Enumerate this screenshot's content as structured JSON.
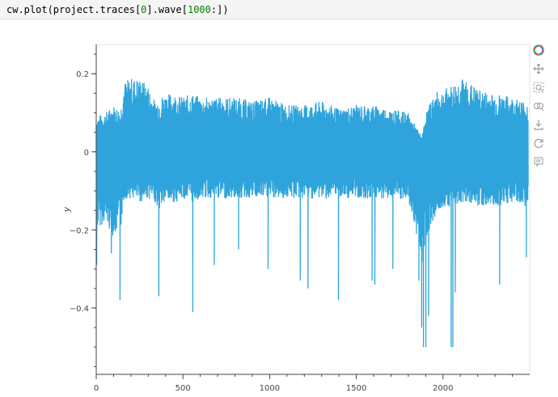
{
  "code": {
    "prefix": "cw.plot(project.traces[",
    "index": "0",
    "middle": "].wave[",
    "slice_start": "1000",
    "suffix": ":])"
  },
  "toolbar": {
    "items": [
      "bokeh-logo-icon",
      "pan-icon",
      "box-zoom-icon",
      "wheel-zoom-icon",
      "save-icon",
      "reset-icon",
      "hover-icon"
    ]
  },
  "chart_data": {
    "type": "line",
    "xlabel": "",
    "ylabel": "y",
    "xlim": [
      0,
      2500
    ],
    "ylim": [
      -0.57,
      0.275
    ],
    "x_ticks": [
      0,
      500,
      1000,
      1500,
      2000
    ],
    "y_ticks": [
      0.2,
      0,
      -0.2,
      -0.4
    ],
    "x_tick_labels": [
      "0",
      "500",
      "1000",
      "1500",
      "2000"
    ],
    "y_tick_labels": [
      "0.2",
      "0",
      "−0.2",
      "−0.4"
    ],
    "series": [
      {
        "color": "#2fa4dc",
        "envelope": {
          "x": [
            0,
            50,
            100,
            140,
            160,
            200,
            250,
            300,
            340,
            360,
            400,
            450,
            500,
            550,
            600,
            700,
            800,
            900,
            1000,
            1100,
            1200,
            1300,
            1400,
            1500,
            1600,
            1700,
            1800,
            1850,
            1880,
            1900,
            1950,
            2000,
            2050,
            2100,
            2150,
            2200,
            2300,
            2400,
            2480
          ],
          "upper": [
            0.09,
            0.1,
            0.12,
            0.11,
            0.18,
            0.19,
            0.19,
            0.17,
            0.13,
            0.14,
            0.15,
            0.15,
            0.14,
            0.15,
            0.14,
            0.14,
            0.14,
            0.13,
            0.14,
            0.12,
            0.12,
            0.13,
            0.11,
            0.12,
            0.12,
            0.11,
            0.1,
            0.06,
            0.04,
            0.1,
            0.15,
            0.16,
            0.17,
            0.19,
            0.18,
            0.16,
            0.15,
            0.14,
            0.13
          ],
          "lower": [
            -0.2,
            -0.18,
            -0.22,
            -0.2,
            -0.12,
            -0.12,
            -0.13,
            -0.12,
            -0.13,
            -0.15,
            -0.13,
            -0.13,
            -0.12,
            -0.13,
            -0.12,
            -0.12,
            -0.12,
            -0.12,
            -0.12,
            -0.12,
            -0.12,
            -0.12,
            -0.12,
            -0.12,
            -0.12,
            -0.12,
            -0.13,
            -0.22,
            -0.3,
            -0.22,
            -0.17,
            -0.14,
            -0.14,
            -0.13,
            -0.13,
            -0.14,
            -0.14,
            -0.13,
            -0.14
          ]
        },
        "spikes": [
          {
            "x": 2,
            "y": -0.29
          },
          {
            "x": 85,
            "y": -0.26
          },
          {
            "x": 135,
            "y": -0.38
          },
          {
            "x": 360,
            "y": -0.37
          },
          {
            "x": 555,
            "y": -0.41
          },
          {
            "x": 680,
            "y": -0.29
          },
          {
            "x": 820,
            "y": -0.25
          },
          {
            "x": 990,
            "y": -0.3
          },
          {
            "x": 1175,
            "y": -0.33
          },
          {
            "x": 1220,
            "y": -0.35
          },
          {
            "x": 1395,
            "y": -0.38
          },
          {
            "x": 1590,
            "y": -0.33
          },
          {
            "x": 1605,
            "y": -0.34
          },
          {
            "x": 1710,
            "y": -0.3
          },
          {
            "x": 1860,
            "y": -0.33
          },
          {
            "x": 1875,
            "y": -0.45
          },
          {
            "x": 1885,
            "y": -0.5
          },
          {
            "x": 1900,
            "y": -0.5
          },
          {
            "x": 1915,
            "y": -0.42
          },
          {
            "x": 2045,
            "y": -0.5
          },
          {
            "x": 2055,
            "y": -0.5
          },
          {
            "x": 2070,
            "y": -0.36
          },
          {
            "x": 2325,
            "y": -0.34
          },
          {
            "x": 2480,
            "y": -0.27
          }
        ]
      }
    ]
  }
}
